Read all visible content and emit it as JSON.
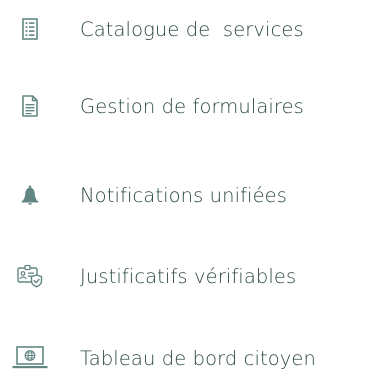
{
  "menu": {
    "items": [
      {
        "label": "Catalogue de  services",
        "icon": "list-document-icon"
      },
      {
        "label": "Gestion de formulaires",
        "icon": "form-document-icon"
      },
      {
        "label": "Notifications unifiées",
        "icon": "bell-icon"
      },
      {
        "label": "Justificatifs vérifiables",
        "icon": "id-badge-shield-icon"
      },
      {
        "label": "Tableau de bord citoyen",
        "icon": "laptop-globe-icon"
      }
    ]
  },
  "colors": {
    "icon": "#628782",
    "text": "#2a4844"
  }
}
